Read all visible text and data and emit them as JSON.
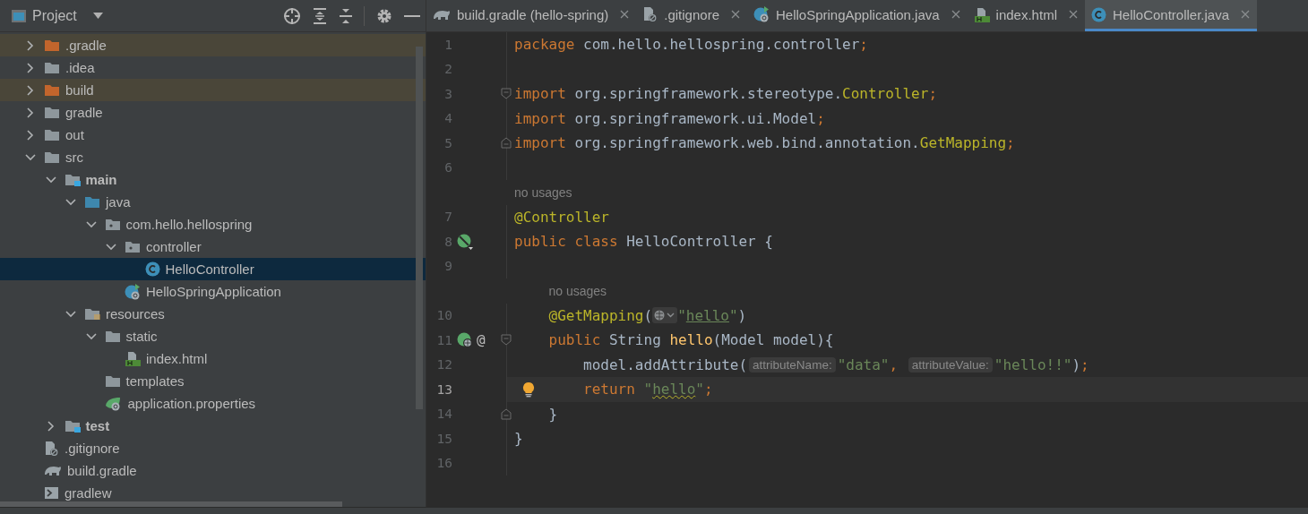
{
  "project_panel": {
    "title": "Project",
    "tree": [
      {
        "label": ".gradle",
        "kind": "folder",
        "expanded": false,
        "excluded": true,
        "selected": false
      },
      {
        "label": ".idea",
        "kind": "folder",
        "expanded": false,
        "excluded": false,
        "selected": false
      },
      {
        "label": "build",
        "kind": "folder",
        "expanded": false,
        "excluded": true,
        "selected": false
      },
      {
        "label": "gradle",
        "kind": "folder",
        "expanded": false,
        "excluded": false,
        "selected": false
      },
      {
        "label": "out",
        "kind": "folder",
        "expanded": false,
        "excluded": false,
        "selected": false
      },
      {
        "label": "src",
        "kind": "folder",
        "expanded": true,
        "excluded": false,
        "selected": false,
        "children": [
          {
            "label": "main",
            "kind": "module",
            "expanded": true,
            "excluded": false,
            "selected": false,
            "children": [
              {
                "label": "java",
                "kind": "source",
                "expanded": true,
                "excluded": false,
                "selected": false,
                "children": [
                  {
                    "label": "com.hello.hellospring",
                    "kind": "package",
                    "expanded": true,
                    "excluded": false,
                    "selected": false,
                    "children": [
                      {
                        "label": "controller",
                        "kind": "package",
                        "expanded": true,
                        "excluded": false,
                        "selected": false,
                        "children": [
                          {
                            "label": "HelloController",
                            "kind": "class",
                            "excluded": false,
                            "selected": true
                          }
                        ]
                      },
                      {
                        "label": "HelloSpringApplication",
                        "kind": "boot",
                        "excluded": false,
                        "selected": false
                      }
                    ]
                  }
                ]
              },
              {
                "label": "resources",
                "kind": "resources",
                "expanded": true,
                "excluded": false,
                "selected": false,
                "children": [
                  {
                    "label": "static",
                    "kind": "folder",
                    "expanded": true,
                    "excluded": false,
                    "selected": false,
                    "children": [
                      {
                        "label": "index.html",
                        "kind": "html",
                        "excluded": false,
                        "selected": false
                      }
                    ]
                  },
                  {
                    "label": "templates",
                    "kind": "folder",
                    "excluded": false,
                    "selected": false
                  },
                  {
                    "label": "application.properties",
                    "kind": "properties",
                    "excluded": false,
                    "selected": false
                  }
                ]
              }
            ]
          },
          {
            "label": "test",
            "kind": "module",
            "expanded": false,
            "excluded": false,
            "selected": false
          }
        ]
      },
      {
        "label": ".gitignore",
        "kind": "ignore",
        "excluded": false,
        "selected": false
      },
      {
        "label": "build.gradle",
        "kind": "gradle",
        "excluded": false,
        "selected": false
      },
      {
        "label": "gradlew",
        "kind": "terminal",
        "excluded": false,
        "selected": false
      }
    ]
  },
  "tabs": [
    {
      "label": "build.gradle (hello-spring)",
      "kind": "gradle",
      "selected": false
    },
    {
      "label": ".gitignore",
      "kind": "ignore",
      "selected": false
    },
    {
      "label": "HelloSpringApplication.java",
      "kind": "boot",
      "selected": false
    },
    {
      "label": "index.html",
      "kind": "html",
      "selected": false
    },
    {
      "label": "HelloController.java",
      "kind": "class",
      "selected": true
    }
  ],
  "editor": {
    "lines": [
      {
        "number": "1",
        "current": false,
        "tokens": [
          {
            "kind": "kw",
            "t": "package"
          },
          {
            "kind": "plain",
            "t": " com.hello.hellospring.controller"
          },
          {
            "kind": "kw",
            "t": ";"
          }
        ]
      },
      {
        "number": "2",
        "current": false
      },
      {
        "number": "3",
        "current": false,
        "gutter": [
          {
            "kind": "fold-start"
          }
        ],
        "tokens": [
          {
            "kind": "kw",
            "t": "import"
          },
          {
            "kind": "plain",
            "t": " org.springframework.stereotype."
          },
          {
            "kind": "ann",
            "t": "Controller"
          },
          {
            "kind": "kw",
            "t": ";"
          }
        ]
      },
      {
        "number": "4",
        "current": false,
        "tokens": [
          {
            "kind": "kw",
            "t": "import"
          },
          {
            "kind": "plain",
            "t": " org.springframework.ui.Model"
          },
          {
            "kind": "kw",
            "t": ";"
          }
        ]
      },
      {
        "number": "5",
        "current": false,
        "gutter": [
          {
            "kind": "fold-end"
          }
        ],
        "tokens": [
          {
            "kind": "kw",
            "t": "import"
          },
          {
            "kind": "plain",
            "t": " org.springframework.web.bind.annotation."
          },
          {
            "kind": "ann",
            "t": "GetMapping"
          },
          {
            "kind": "kw",
            "t": ";"
          }
        ]
      },
      {
        "number": "6",
        "current": false
      },
      {
        "number": "7",
        "current": false,
        "usages": "no usages",
        "tokens": [
          {
            "kind": "ann",
            "t": "@Controller"
          }
        ]
      },
      {
        "number": "8",
        "current": false,
        "gutter": [
          {
            "kind": "bean"
          }
        ],
        "tokens": [
          {
            "kind": "kw",
            "t": "public class "
          },
          {
            "kind": "plain",
            "t": "HelloController {"
          }
        ]
      },
      {
        "number": "9",
        "current": false
      },
      {
        "number": "10",
        "current": false,
        "usages": "no usages",
        "tokens": [
          {
            "kind": "ann",
            "t": "    @GetMapping"
          },
          {
            "kind": "plain",
            "t": "("
          },
          {
            "kind": "globe"
          },
          {
            "kind": "str",
            "t": "\""
          },
          {
            "kind": "str-link",
            "t": "hello"
          },
          {
            "kind": "str",
            "t": "\""
          },
          {
            "kind": "plain",
            "t": ")"
          }
        ]
      },
      {
        "number": "11",
        "current": false,
        "gutter": [
          {
            "kind": "web"
          },
          {
            "kind": "text",
            "text": "@"
          },
          {
            "kind": "fold-start"
          }
        ],
        "tokens": [
          {
            "kind": "kw",
            "t": "    public "
          },
          {
            "kind": "plain",
            "t": "String "
          },
          {
            "kind": "method",
            "t": "hello"
          },
          {
            "kind": "plain",
            "t": "(Model model){"
          }
        ]
      },
      {
        "number": "12",
        "current": false,
        "tokens": [
          {
            "kind": "plain",
            "t": "        model.addAttribute("
          },
          {
            "kind": "hint",
            "t": "attributeName:"
          },
          {
            "kind": "str",
            "t": "\"data\""
          },
          {
            "kind": "kw",
            "t": ", "
          },
          {
            "kind": "hint",
            "t": "attributeValue:"
          },
          {
            "kind": "str",
            "t": "\"hello!!\""
          },
          {
            "kind": "plain",
            "t": ")"
          },
          {
            "kind": "kw",
            "t": ";"
          }
        ]
      },
      {
        "number": "13",
        "current": true,
        "tokens": [
          {
            "kind": "bulb"
          },
          {
            "kind": "kw",
            "t": "        return "
          },
          {
            "kind": "str",
            "t": "\""
          },
          {
            "kind": "str-typo",
            "t": "hello"
          },
          {
            "kind": "str",
            "t": "\""
          },
          {
            "kind": "kw",
            "t": ";"
          }
        ]
      },
      {
        "number": "14",
        "current": false,
        "gutter": [
          {
            "kind": "fold-end"
          }
        ],
        "tokens": [
          {
            "kind": "plain",
            "t": "    }"
          }
        ]
      },
      {
        "number": "15",
        "current": false,
        "tokens": [
          {
            "kind": "plain",
            "t": "}"
          }
        ]
      },
      {
        "number": "16",
        "current": false
      }
    ]
  }
}
